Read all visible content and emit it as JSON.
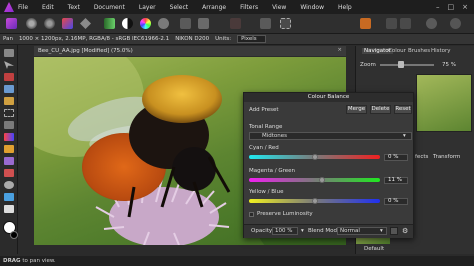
{
  "menubar": {
    "items": [
      "File",
      "Edit",
      "Text",
      "Document",
      "Layer",
      "Select",
      "Arrange",
      "Filters",
      "View",
      "Window",
      "Help"
    ]
  },
  "context": {
    "tool": "Pan",
    "doc_info": "1000 × 1200px, 2.16MP, RGBA/8 - sRGB IEC61966-2.1",
    "camera": "NIKON D200",
    "units_label": "Units:",
    "units_value": "Pixels"
  },
  "document": {
    "tab_title": "Bee_CU_AA.jpg [Modified] (75.0%)",
    "close": "×"
  },
  "right_panel": {
    "tabs": [
      "Navigator",
      "Colour",
      "Brushes",
      "History"
    ],
    "zoom_label": "Zoom",
    "zoom_value": "75 %",
    "hidden_tabs": [
      "fects",
      "Transform"
    ],
    "thumb_label": "Default"
  },
  "dialog": {
    "title": "Colour Balance",
    "add_preset": "Add Preset",
    "merge": "Merge",
    "delete": "Delete",
    "reset": "Reset",
    "tonal_range_label": "Tonal Range",
    "tonal_range_value": "Midtones",
    "sliders": [
      {
        "label": "Cyan / Red",
        "value": "0 %",
        "fraction": 0.5
      },
      {
        "label": "Magenta / Green",
        "value": "11 %",
        "fraction": 0.555
      },
      {
        "label": "Yellow / Blue",
        "value": "0 %",
        "fraction": 0.5
      }
    ],
    "preserve_luminosity": "Preserve Luminosity",
    "opacity_label": "Opacity:",
    "opacity_value": "100 %",
    "blend_label": "Blend Mode:",
    "blend_value": "Normal"
  },
  "status": {
    "hint_bold": "DRAG",
    "hint": " to pan view."
  }
}
